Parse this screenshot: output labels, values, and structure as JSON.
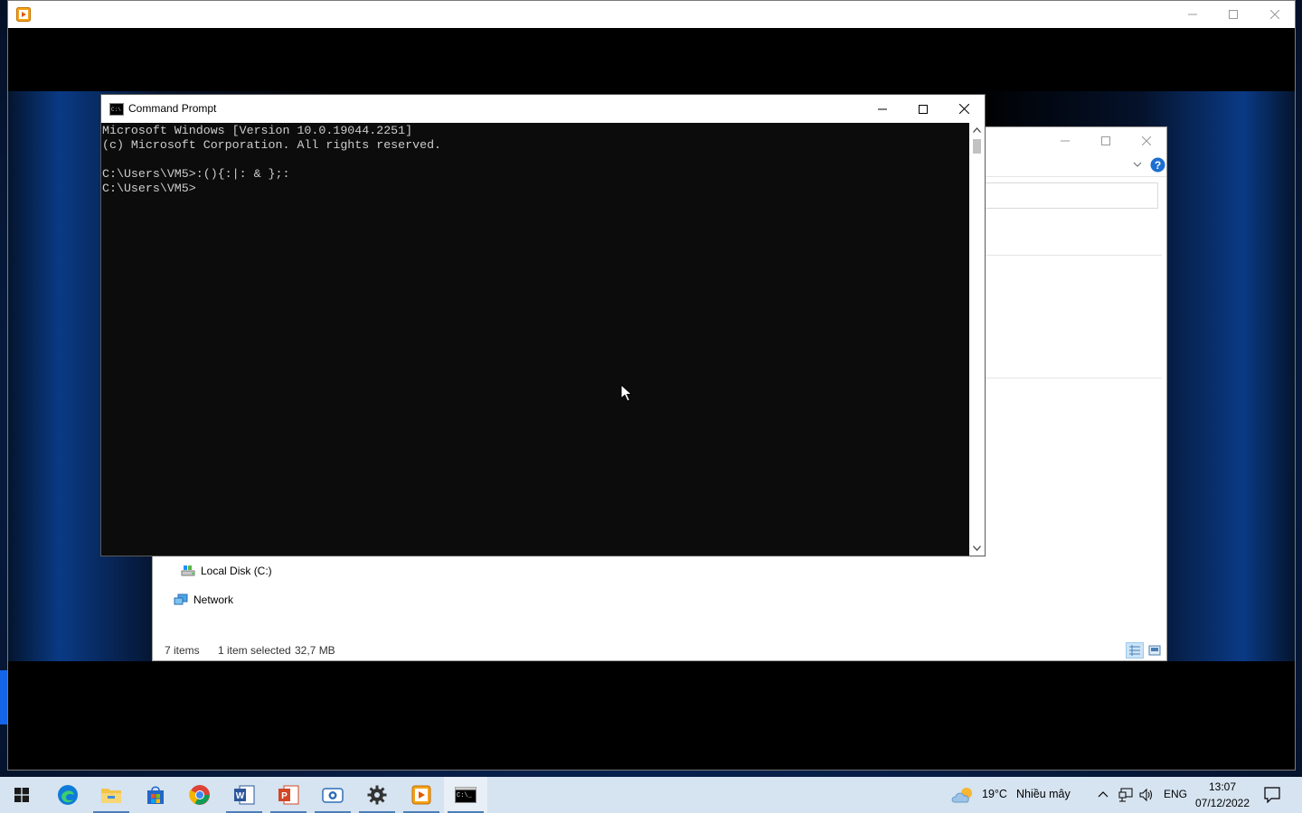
{
  "colors": {
    "accent": "#1565e8",
    "taskbar": "#d6e3f0",
    "cmd_bg": "#0c0c0c",
    "cmd_text": "#cccccc"
  },
  "vm": {
    "app_icon": "player-app-icon",
    "controls": {
      "minimize": "minimize-icon",
      "maximize": "maximize-icon",
      "close": "close-icon"
    }
  },
  "explorer": {
    "nav": [
      {
        "label": "Local Disk (C:)",
        "icon": "drive-icon"
      },
      {
        "label": "Network",
        "icon": "network-icon"
      }
    ],
    "status": {
      "items": "7 items",
      "selected": "1 item selected",
      "size": "32,7 MB"
    },
    "view_buttons": [
      "details-view-icon",
      "large-icons-view-icon"
    ],
    "help_icon": "help-icon"
  },
  "cmd": {
    "title": "Command Prompt",
    "lines": [
      "Microsoft Windows [Version 10.0.19044.2251]",
      "(c) Microsoft Corporation. All rights reserved.",
      "",
      "C:\\Users\\VM5>:(){:|: & };:",
      "C:\\Users\\VM5>"
    ]
  },
  "taskbar": {
    "apps": [
      {
        "name": "start",
        "icon": "windows-start-icon"
      },
      {
        "name": "edge",
        "icon": "edge-icon"
      },
      {
        "name": "file-explorer",
        "icon": "folder-icon"
      },
      {
        "name": "store",
        "icon": "store-icon"
      },
      {
        "name": "chrome",
        "icon": "chrome-icon"
      },
      {
        "name": "word",
        "icon": "word-icon"
      },
      {
        "name": "powerpoint",
        "icon": "powerpoint-icon"
      },
      {
        "name": "camera",
        "icon": "camera-icon"
      },
      {
        "name": "settings",
        "icon": "gear-icon"
      },
      {
        "name": "player",
        "icon": "player-app-icon"
      },
      {
        "name": "command-prompt",
        "icon": "cmd-icon"
      }
    ],
    "weather": {
      "temp": "19°C",
      "condition": "Nhiều mây"
    },
    "tray": {
      "language": "ENG"
    },
    "clock": {
      "time": "13:07",
      "date": "07/12/2022"
    }
  }
}
